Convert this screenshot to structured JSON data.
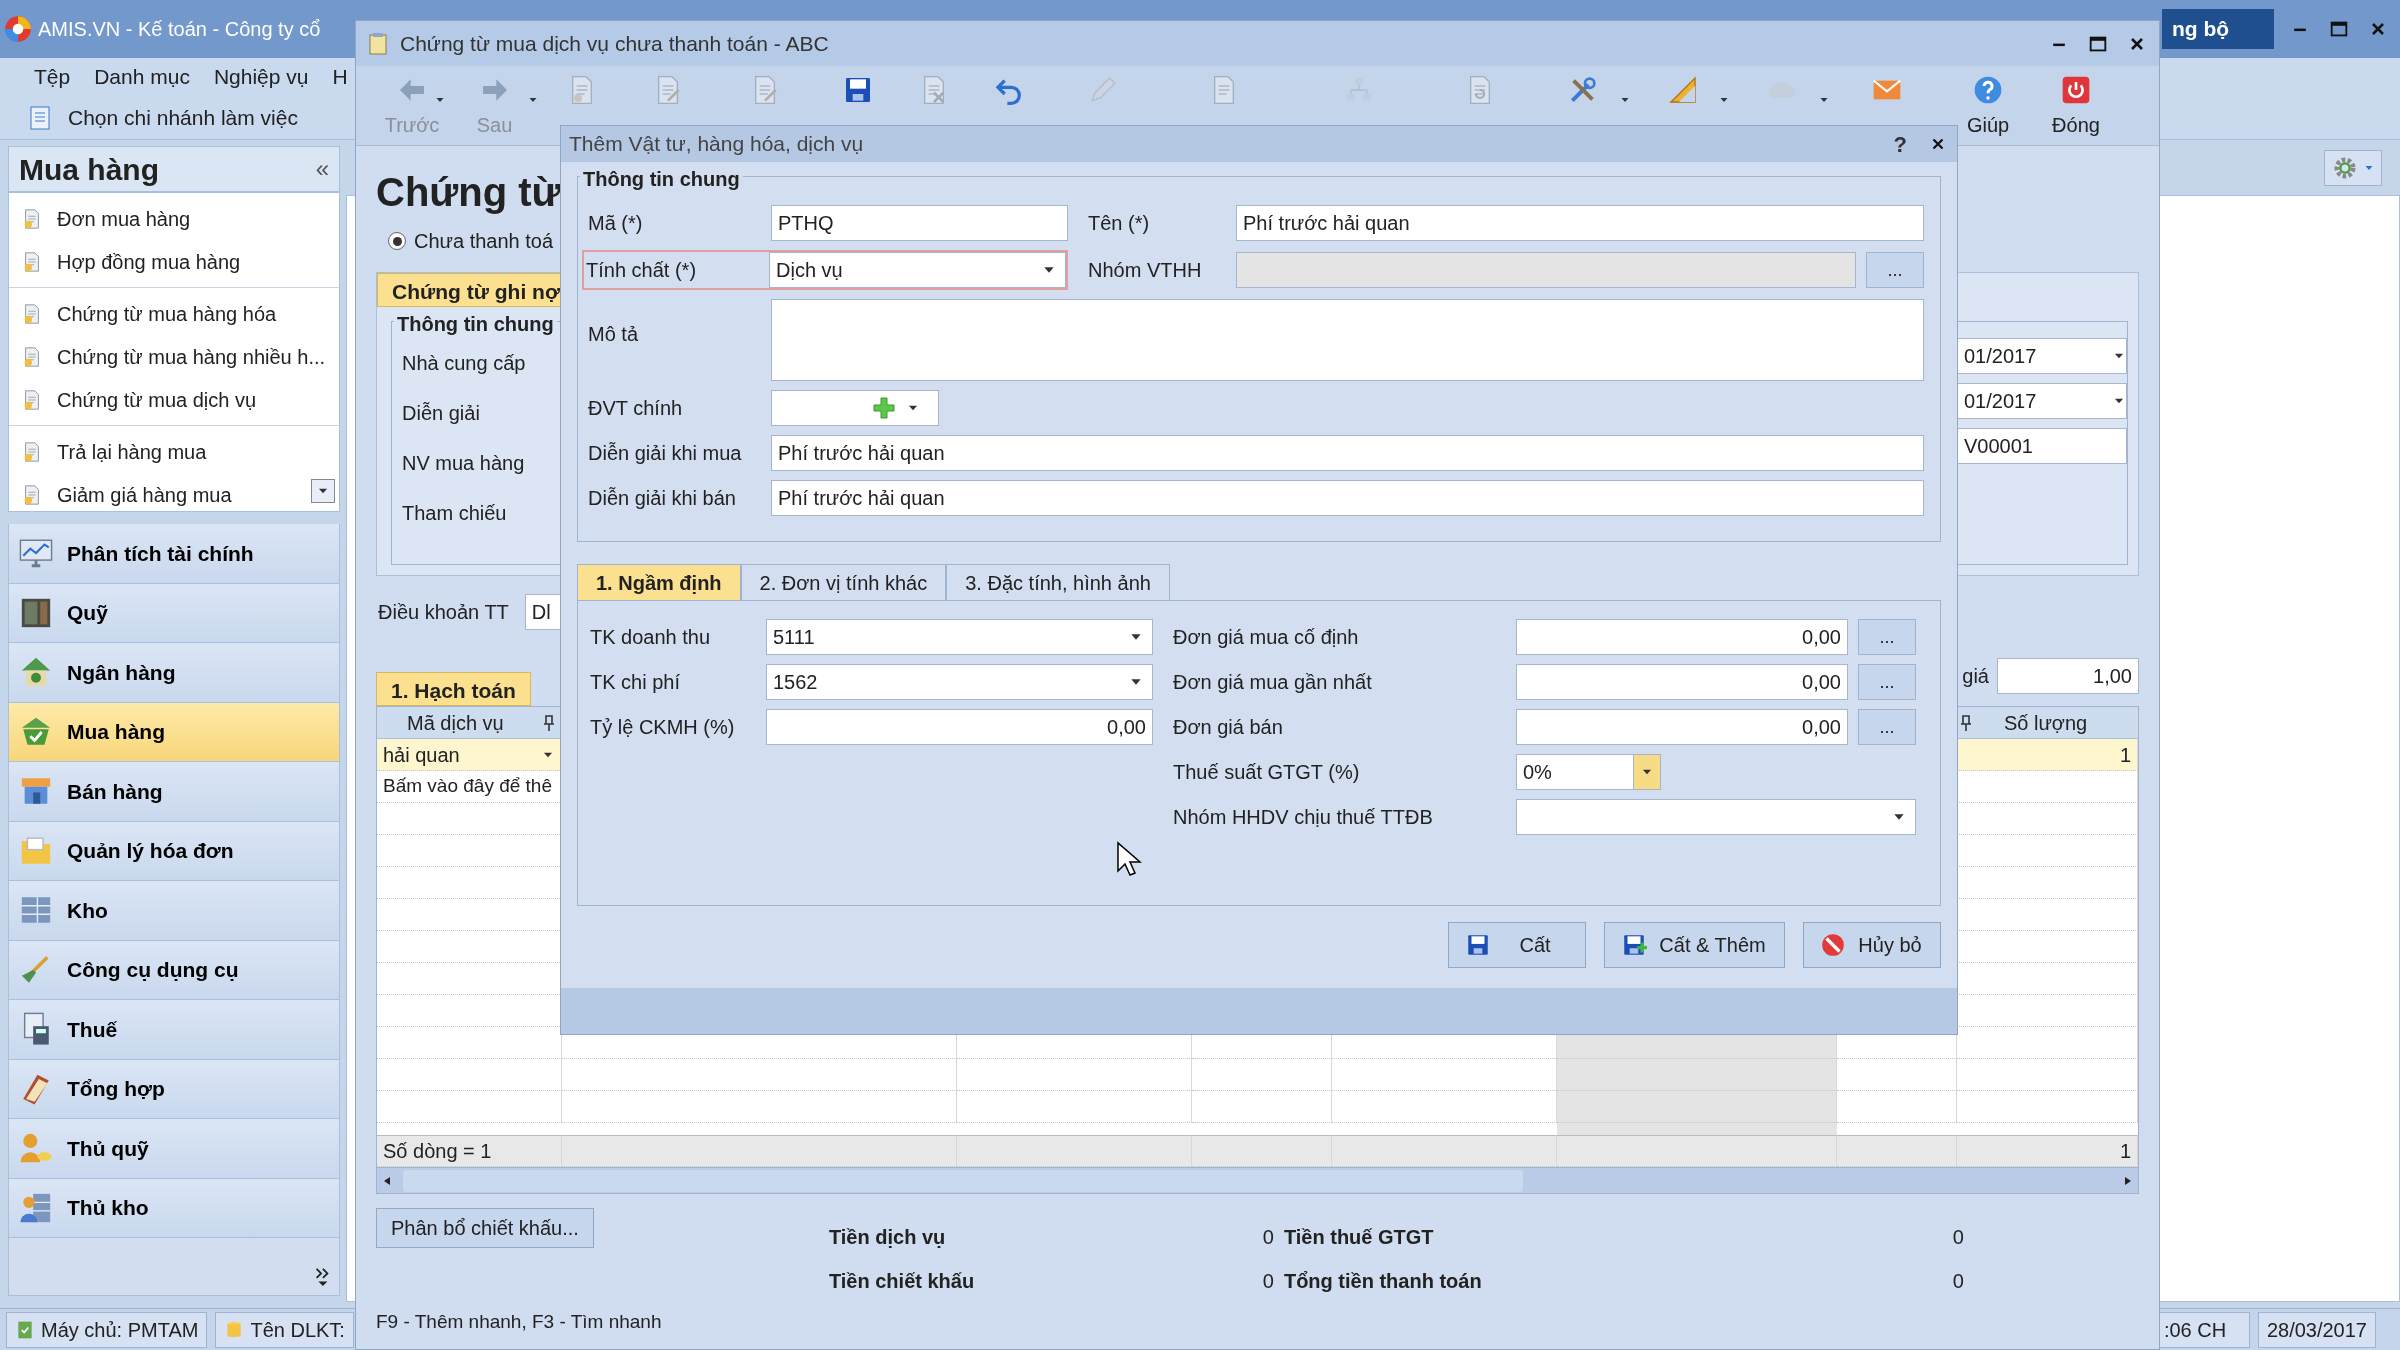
{
  "app": {
    "title": "AMIS.VN - Kế toán - Công ty cổ",
    "sync_button": "ng bộ",
    "menu": [
      "Tệp",
      "Danh mục",
      "Nghiệp vụ",
      "H"
    ],
    "branch_button": "Chọn chi nhánh làm việc"
  },
  "sidebar": {
    "title": "Mua hàng",
    "collapse": "«",
    "item_groups": [
      [
        "Đơn mua hàng",
        "Hợp đồng mua hàng"
      ],
      [
        "Chứng từ mua hàng hóa",
        "Chứng từ mua hàng nhiều h...",
        "Chứng từ mua dịch vụ"
      ],
      [
        "Trả lại hàng mua",
        "Giảm giá hàng mua"
      ]
    ],
    "modules": [
      {
        "kind": "chart",
        "label": "Phân tích tài chính",
        "selected": false
      },
      {
        "kind": "safe",
        "label": "Quỹ",
        "selected": false
      },
      {
        "kind": "bank",
        "label": "Ngân hàng",
        "selected": false
      },
      {
        "kind": "basket",
        "label": "Mua hàng",
        "selected": true
      },
      {
        "kind": "shop",
        "label": "Bán hàng",
        "selected": false
      },
      {
        "kind": "folder",
        "label": "Quản lý hóa đơn",
        "selected": false
      },
      {
        "kind": "shelf",
        "label": "Kho",
        "selected": false
      },
      {
        "kind": "shovel",
        "label": "Công cụ dụng cụ",
        "selected": false
      },
      {
        "kind": "calculator",
        "label": "Thuế",
        "selected": false
      },
      {
        "kind": "book",
        "label": "Tổng hợp",
        "selected": false
      },
      {
        "kind": "cashier",
        "label": "Thủ quỹ",
        "selected": false
      },
      {
        "kind": "storekeeper",
        "label": "Thủ kho",
        "selected": false
      }
    ]
  },
  "status_bar": {
    "items": [
      {
        "kind": "server",
        "label": "Máy chủ: PMTAM"
      },
      {
        "kind": "database",
        "label": "Tên DLKT:"
      }
    ],
    "time": ":06 CH",
    "date": "28/03/2017"
  },
  "document_window": {
    "title": "Chứng từ mua dịch vụ chưa thanh toán - ABC",
    "toolbar": [
      {
        "kind": "back",
        "label": "Trước",
        "dropdown": true,
        "disabled": true
      },
      {
        "kind": "forward",
        "label": "Sau",
        "dropdown": true,
        "disabled": true
      },
      {
        "kind": "doc-person",
        "dropdown": false,
        "disabled": true
      },
      {
        "kind": "doc-edit",
        "dropdown": false,
        "disabled": true
      },
      {
        "kind": "doc-edit",
        "dropdown": false,
        "disabled": true
      },
      {
        "kind": "save",
        "dropdown": false,
        "disabled": false
      },
      {
        "kind": "doc-delete",
        "dropdown": false,
        "disabled": true
      },
      {
        "kind": "undo",
        "dropdown": false,
        "disabled": false
      },
      {
        "kind": "pencil",
        "dropdown": false,
        "disabled": true
      },
      {
        "kind": "doc",
        "dropdown": false,
        "disabled": true
      },
      {
        "kind": "network",
        "dropdown": false,
        "disabled": true
      },
      {
        "kind": "doc-refresh",
        "dropdown": false,
        "disabled": true
      },
      {
        "kind": "tools",
        "dropdown": true,
        "disabled": false
      },
      {
        "kind": "ruler",
        "dropdown": true,
        "disabled": false
      },
      {
        "kind": "cloud",
        "dropdown": true,
        "disabled": true
      },
      {
        "kind": "mail",
        "dropdown": false,
        "disabled": false
      },
      {
        "kind": "help",
        "label": "Giúp",
        "dropdown": false,
        "disabled": false
      },
      {
        "kind": "power",
        "label": "Đóng",
        "dropdown": false,
        "disabled": false
      }
    ],
    "heading": "Chứng từ",
    "radio": {
      "label": "Chưa thanh toá",
      "selected": true
    },
    "panel_tab": "Chứng từ ghi nợ",
    "group_title": "Thông tin chung",
    "labels": [
      "Nhà cung cấp",
      "Diễn giải",
      "NV mua hàng",
      "Tham chiếu"
    ],
    "right_fields": [
      {
        "kind": "date",
        "value": "01/2017"
      },
      {
        "kind": "date",
        "value": "01/2017"
      },
      {
        "kind": "text",
        "value": "V00001"
      }
    ],
    "terms": {
      "label": "Điều khoản TT",
      "value": "Dl"
    },
    "grid_tab": {
      "label": "1. Hạch toán",
      "selected": true
    },
    "rate": {
      "label": "giá",
      "value": "1,00"
    },
    "grid": {
      "columns": [
        "Mã dịch vụ",
        "Số lượng"
      ],
      "rows": [
        {
          "service_code": "hải quan",
          "quantity": "1"
        }
      ],
      "new_row_hint": "Bấm vào đây để thê",
      "row_count": "Số dòng = 1",
      "total_quantity": "1"
    },
    "allocate_button": "Phân bổ chiết khấu...",
    "totals": [
      {
        "label": "Tiền dịch vụ",
        "value": "0"
      },
      {
        "label": "Tiền thuế GTGT",
        "value": "0"
      },
      {
        "label": "Tiền chiết khấu",
        "value": "0"
      },
      {
        "label": "Tổng tiền thanh toán",
        "value": "0"
      }
    ],
    "hint": "F9 - Thêm nhanh, F3 - Tìm nhanh"
  },
  "dialog": {
    "title": "Thêm Vật tư, hàng hóa, dịch vụ",
    "help": "?",
    "group_title": "Thông tin chung",
    "code": {
      "label": "Mã (*)",
      "value": "PTHQ"
    },
    "name": {
      "label": "Tên (*)",
      "value": "Phí trước hải quan"
    },
    "nature": {
      "label": "Tính chất (*)",
      "value": "Dịch vụ",
      "focused": true
    },
    "material_group": {
      "label": "Nhóm VTHH",
      "disabled": true,
      "button": "..."
    },
    "description": {
      "label": "Mô tả"
    },
    "unit": {
      "label": "ĐVT chính"
    },
    "purchase_desc": {
      "label": "Diễn giải khi mua",
      "value": "Phí trước hải quan"
    },
    "sale_desc": {
      "label": "Diễn giải khi bán",
      "value": "Phí trước hải quan"
    },
    "tabs": [
      {
        "label": "1. Ngầm định",
        "selected": true
      },
      {
        "label": "2. Đơn vị tính khác",
        "selected": false
      },
      {
        "label": "3. Đặc tính, hình ảnh",
        "selected": false
      }
    ],
    "left_fields": [
      {
        "kind": "dropdown",
        "label": "TK doanh thu",
        "value": "5111"
      },
      {
        "kind": "dropdown",
        "label": "TK chi phí",
        "value": "1562"
      },
      {
        "kind": "number",
        "label": "Tỷ lệ CKMH (%)",
        "value": "0,00"
      }
    ],
    "right_fields": [
      {
        "kind": "lookup",
        "label": "Đơn giá mua cố định",
        "value": "0,00",
        "button": "..."
      },
      {
        "kind": "lookup",
        "label": "Đơn giá mua gần nhất",
        "value": "0,00",
        "button": "..."
      },
      {
        "kind": "lookup",
        "label": "Đơn giá bán",
        "value": "0,00",
        "button": "..."
      },
      {
        "kind": "small-dropdown",
        "label": "Thuế suất GTGT (%)",
        "value": "0%"
      },
      {
        "kind": "dropdown",
        "label": "Nhóm HHDV chịu thuế TTĐB"
      }
    ],
    "buttons": [
      {
        "kind": "save",
        "label": "Cất"
      },
      {
        "kind": "save-add",
        "label": "Cất & Thêm"
      },
      {
        "kind": "cancel",
        "label": "Hủy bỏ"
      }
    ]
  }
}
